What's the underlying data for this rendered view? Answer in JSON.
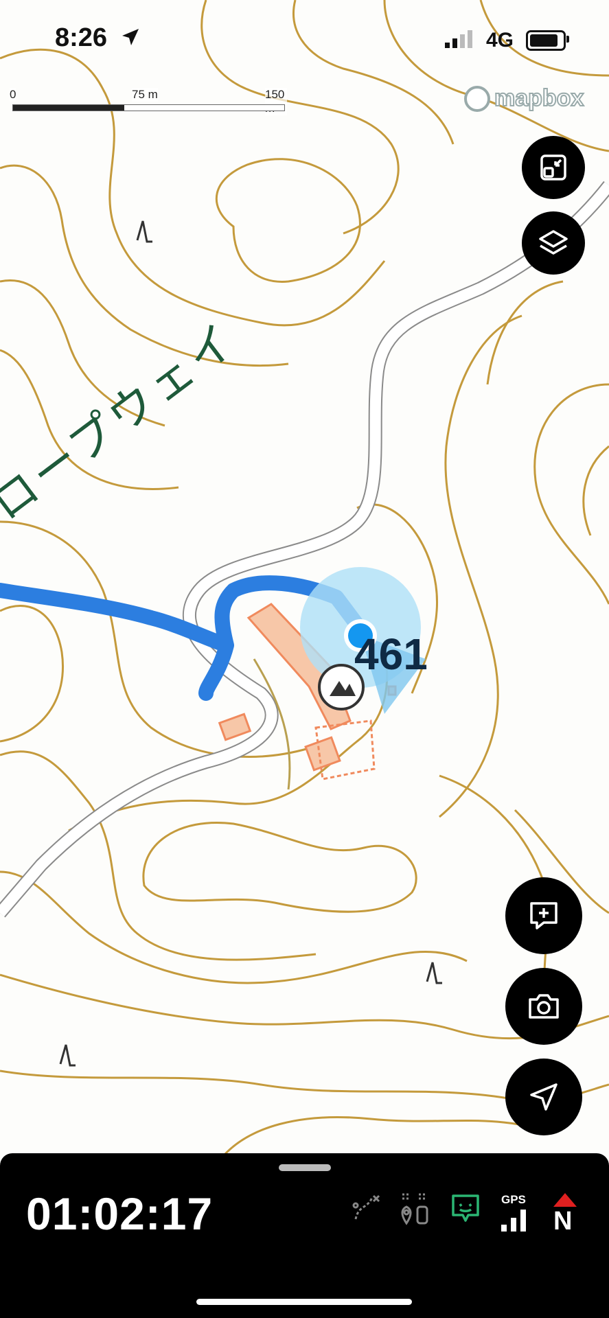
{
  "status_bar": {
    "time": "8:26",
    "network": "4G"
  },
  "map": {
    "scale_bar": {
      "labels": [
        "0",
        "75 m",
        "150 m"
      ],
      "fill_fraction": 0.41
    },
    "attribution": "mapbox",
    "place_label": "ロープウェイ",
    "elevation_label": "461",
    "user_location": {
      "accuracy_color": "#aee0f7",
      "dot_color": "#1497f0"
    },
    "colors": {
      "contour": "#c49a3c",
      "track": "#2c7ee0",
      "road": "#8a8a8a",
      "building": "#f08a5d",
      "label_green": "#1e5a3a"
    }
  },
  "controls": {
    "icons": [
      "fullscreen-exit-icon",
      "layers-icon",
      "add-note-icon",
      "camera-icon",
      "navigation-arrow-icon"
    ]
  },
  "bottom_panel": {
    "elapsed_time": "01:02:17",
    "gps_label": "GPS",
    "north_label": "N",
    "icons": [
      "route-disabled-icon",
      "waypoint-icon",
      "message-icon",
      "gps-signal-icon",
      "compass-north-icon"
    ],
    "accent_green": "#2bb673",
    "accent_red": "#e02020"
  }
}
